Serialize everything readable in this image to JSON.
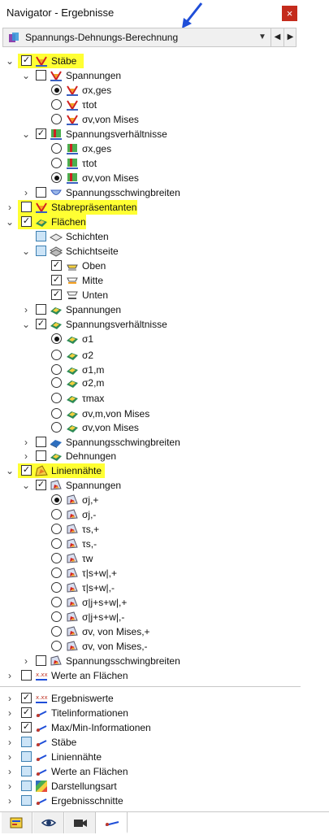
{
  "window": {
    "title": "Navigator - Ergebnisse",
    "close_label": "×"
  },
  "combo": {
    "value": "Spannungs-Dehnungs-Berechnung",
    "dropdown": "▼",
    "prev": "◀",
    "next": "▶"
  },
  "tree": {
    "staebe": "Stäbe",
    "staebe_spannungen": "Spannungen",
    "sx_ges": "σx,ges",
    "t_tot": "τtot",
    "sv_mises": "σv,von Mises",
    "staebe_sv": "Spannungsverhältnisse",
    "sv_sx_ges": "σx,ges",
    "sv_t_tot": "τtot",
    "sv_sv_mises": "σv,von Mises",
    "staebe_ssb": "Spannungsschwingbreiten",
    "stabrepraesentanten": "Stabrepräsentanten",
    "flaechen": "Flächen",
    "schichten": "Schichten",
    "schichtseite": "Schichtseite",
    "oben": "Oben",
    "mitte": "Mitte",
    "unten": "Unten",
    "fl_spannungen": "Spannungen",
    "fl_sv": "Spannungsverhältnisse",
    "fl_s1": "σ1",
    "fl_s2": "σ2",
    "fl_s1m": "σ1,m",
    "fl_s2m": "σ2,m",
    "fl_tmax": "τmax",
    "fl_svm_mises": "σv,m,von Mises",
    "fl_sv_mises": "σv,von Mises",
    "fl_ssb": "Spannungsschwingbreiten",
    "fl_dehnungen": "Dehnungen",
    "liniennaehte": "Liniennähte",
    "ln_spannungen": "Spannungen",
    "ln_sj_plus": "σj,+",
    "ln_sj_minus": "σj,-",
    "ln_ts_plus": "τs,+",
    "ln_ts_minus": "τs,-",
    "ln_tw": "τw",
    "ln_tsw_plus": "τ|s+w|,+",
    "ln_tsw_minus": "τ|s+w|,-",
    "ln_sjsw_plus": "σ|j+s+w|,+",
    "ln_sjsw_minus": "σ|j+s+w|,-",
    "ln_sv_mises_plus": "σv, von Mises,+",
    "ln_sv_mises_minus": "σv, von Mises,-",
    "ln_ssb": "Spannungsschwingbreiten",
    "werte_an_flaechen": "Werte an Flächen"
  },
  "tree2": {
    "ergebniswerte": "Ergebniswerte",
    "titelinformationen": "Titelinformationen",
    "maxmin": "Max/Min-Informationen",
    "staebe": "Stäbe",
    "liniennaehte": "Liniennähte",
    "werte_an_flaechen": "Werte an Flächen",
    "darstellungsart": "Darstellungsart",
    "ergebnisschnitte": "Ergebnisschnitte"
  },
  "glyphs": {
    "expanded": "⌄",
    "collapsed": "›",
    "check": "✓"
  },
  "colors": {
    "highlight": "#ffff33",
    "accent": "#1f4ed8",
    "close": "#c42b1c"
  },
  "icons": {
    "tabs": [
      "data-icon",
      "eye-icon",
      "camera-icon",
      "result-diagram-icon"
    ]
  }
}
